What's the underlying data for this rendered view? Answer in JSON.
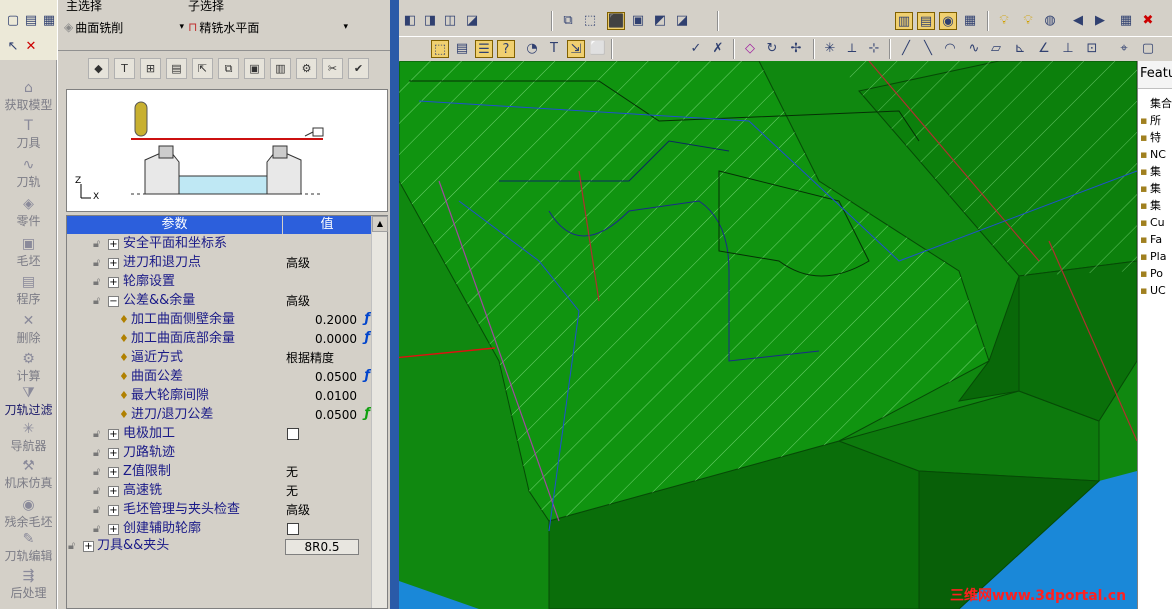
{
  "left_strip": {
    "items": [
      {
        "label": "获取模型",
        "icon": "model-icon"
      },
      {
        "label": "刀具",
        "icon": "tool-icon"
      },
      {
        "label": "刀轨",
        "icon": "toolpath-icon"
      },
      {
        "label": "零件",
        "icon": "part-icon"
      },
      {
        "label": "毛坯",
        "icon": "stock-icon"
      },
      {
        "label": "程序",
        "icon": "program-icon"
      },
      {
        "label": "删除",
        "icon": "delete-icon"
      },
      {
        "label": "计算",
        "icon": "compute-icon"
      },
      {
        "label": "刀轨过滤",
        "icon": "filter-icon"
      },
      {
        "label": "导航器",
        "icon": "navigator-icon"
      },
      {
        "label": "机床仿真",
        "icon": "simulation-icon"
      },
      {
        "label": "残余毛坯",
        "icon": "residual-stock-icon"
      },
      {
        "label": "刀轨编辑",
        "icon": "edit-icon"
      },
      {
        "label": "后处理",
        "icon": "post-icon"
      }
    ]
  },
  "panel": {
    "main_select_label": "主选择",
    "main_select_value": "曲面铣削",
    "sub_select_label": "子选择",
    "sub_select_value": "精铣水平面",
    "preview_axis_z": "Z",
    "preview_axis_x": "X"
  },
  "table": {
    "col_param": "参数",
    "col_value": "值",
    "rows": [
      {
        "name": "安全平面和坐标系",
        "value": "",
        "type": "group",
        "expanded": false
      },
      {
        "name": "进刀和退刀点",
        "value": "高级",
        "type": "group",
        "expanded": false
      },
      {
        "name": "轮廓设置",
        "value": "",
        "type": "group",
        "expanded": false
      },
      {
        "name": "公差&&余量",
        "value": "高级",
        "type": "group",
        "expanded": true
      },
      {
        "name": "加工曲面侧壁余量",
        "value": "0.2000",
        "type": "param",
        "fx": "blue"
      },
      {
        "name": "加工曲面底部余量",
        "value": "0.0000",
        "type": "param",
        "fx": "blue"
      },
      {
        "name": "逼近方式",
        "value": "根据精度",
        "type": "param",
        "fx": ""
      },
      {
        "name": "曲面公差",
        "value": "0.0500",
        "type": "param",
        "fx": "blue"
      },
      {
        "name": "最大轮廓间隙",
        "value": "0.0100",
        "type": "param",
        "fx": ""
      },
      {
        "name": "进刀/退刀公差",
        "value": "0.0500",
        "type": "param",
        "fx": "green"
      },
      {
        "name": "电极加工",
        "value": "",
        "type": "group-check",
        "expanded": false
      },
      {
        "name": "刀路轨迹",
        "value": "",
        "type": "group",
        "expanded": false
      },
      {
        "name": "Z值限制",
        "value": "无",
        "type": "group",
        "expanded": false
      },
      {
        "name": "高速铣",
        "value": "无",
        "type": "group",
        "expanded": false
      },
      {
        "name": "毛坯管理与夹头检查",
        "value": "高级",
        "type": "group",
        "expanded": false
      },
      {
        "name": "创建辅助轮廓",
        "value": "",
        "type": "group-check",
        "expanded": false
      }
    ],
    "footer_name": "刀具&&夹头",
    "footer_value": "8R0.5"
  },
  "tree": {
    "header": "Features",
    "items": [
      "集合",
      "所",
      "特",
      "NC",
      "集",
      "集",
      "集",
      "Cu",
      "Fa",
      "Pla",
      "Po",
      "UC"
    ]
  },
  "watermark": "三维网www.3dportal.cn",
  "colors": {
    "accent": "#2c5fdc",
    "viewport_bg": "#0b7c0b",
    "splitter": "#2a5aa8"
  }
}
